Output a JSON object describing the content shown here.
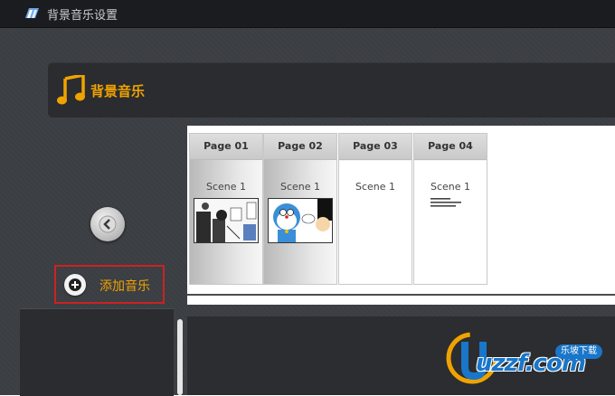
{
  "window": {
    "title": "背景音乐设置"
  },
  "header": {
    "title": "背景音乐"
  },
  "sidebar": {
    "add_music_label": "添加音乐"
  },
  "pages": [
    {
      "tab": "Page 01",
      "scene": "Scene 1",
      "thumb": "comic-1"
    },
    {
      "tab": "Page 02",
      "scene": "Scene 1",
      "thumb": "comic-2"
    },
    {
      "tab": "Page 03",
      "scene": "Scene 1",
      "thumb": ""
    },
    {
      "tab": "Page 04",
      "scene": "Scene 1",
      "thumb": "text-note"
    }
  ],
  "watermark": {
    "text": "uzzf.com",
    "badge": "乐坡下载"
  },
  "colors": {
    "accent": "#f0a300",
    "highlight_border": "#cc2222",
    "bg": "#3b3e43",
    "titlebar": "#1b1c1f"
  },
  "icons": {
    "app": "app-icon",
    "note": "music-note-icon",
    "prev": "chevron-left-icon",
    "add": "plus-icon"
  }
}
